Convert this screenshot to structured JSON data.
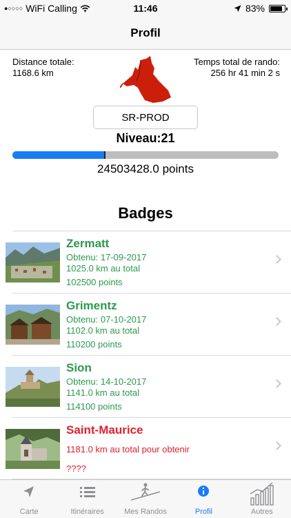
{
  "status_bar": {
    "carrier": "WiFi Calling",
    "time": "11:46",
    "battery_percent": "83%",
    "battery_level": 0.83
  },
  "nav": {
    "title": "Profil"
  },
  "profile": {
    "distance_label": "Distance totale:",
    "distance_value": "1168.6 km",
    "time_label": "Temps total de rando:",
    "time_value": "256 hr 41 min 2 s",
    "username": "SR-PROD",
    "level": "Niveau:21",
    "progress_fraction": 0.35,
    "points": "24503428.0 points"
  },
  "badges": {
    "title": "Badges",
    "items": [
      {
        "name": "Zermatt",
        "line1": "Obtenu: 17-09-2017",
        "line2": "1025.0 km au total",
        "line3": "102500 points",
        "status": "earned"
      },
      {
        "name": "Grimentz",
        "line1": "Obtenu: 07-10-2017",
        "line2": "1102.0 km au total",
        "line3": "110200 points",
        "status": "earned"
      },
      {
        "name": "Sion",
        "line1": "Obtenu: 14-10-2017",
        "line2": "1141.0 km au total",
        "line3": "114100 points",
        "status": "earned"
      },
      {
        "name": "Saint-Maurice",
        "line1": "1181.0 km au total pour obtenir",
        "line2": "????",
        "status": "locked"
      }
    ]
  },
  "tabs": [
    {
      "label": "Carte",
      "icon": "location-arrow-icon"
    },
    {
      "label": "Itinéraires",
      "icon": "list-icon"
    },
    {
      "label": "Mes Randos",
      "icon": "hiker-icon"
    },
    {
      "label": "Profil",
      "icon": "info-icon",
      "active": true
    },
    {
      "label": "Autres",
      "icon": "bar-chart-icon"
    }
  ],
  "colors": {
    "accent": "#1a7cf5",
    "earned": "#2a9a4c",
    "locked": "#e0202c",
    "logo": "#cc1f0b"
  }
}
